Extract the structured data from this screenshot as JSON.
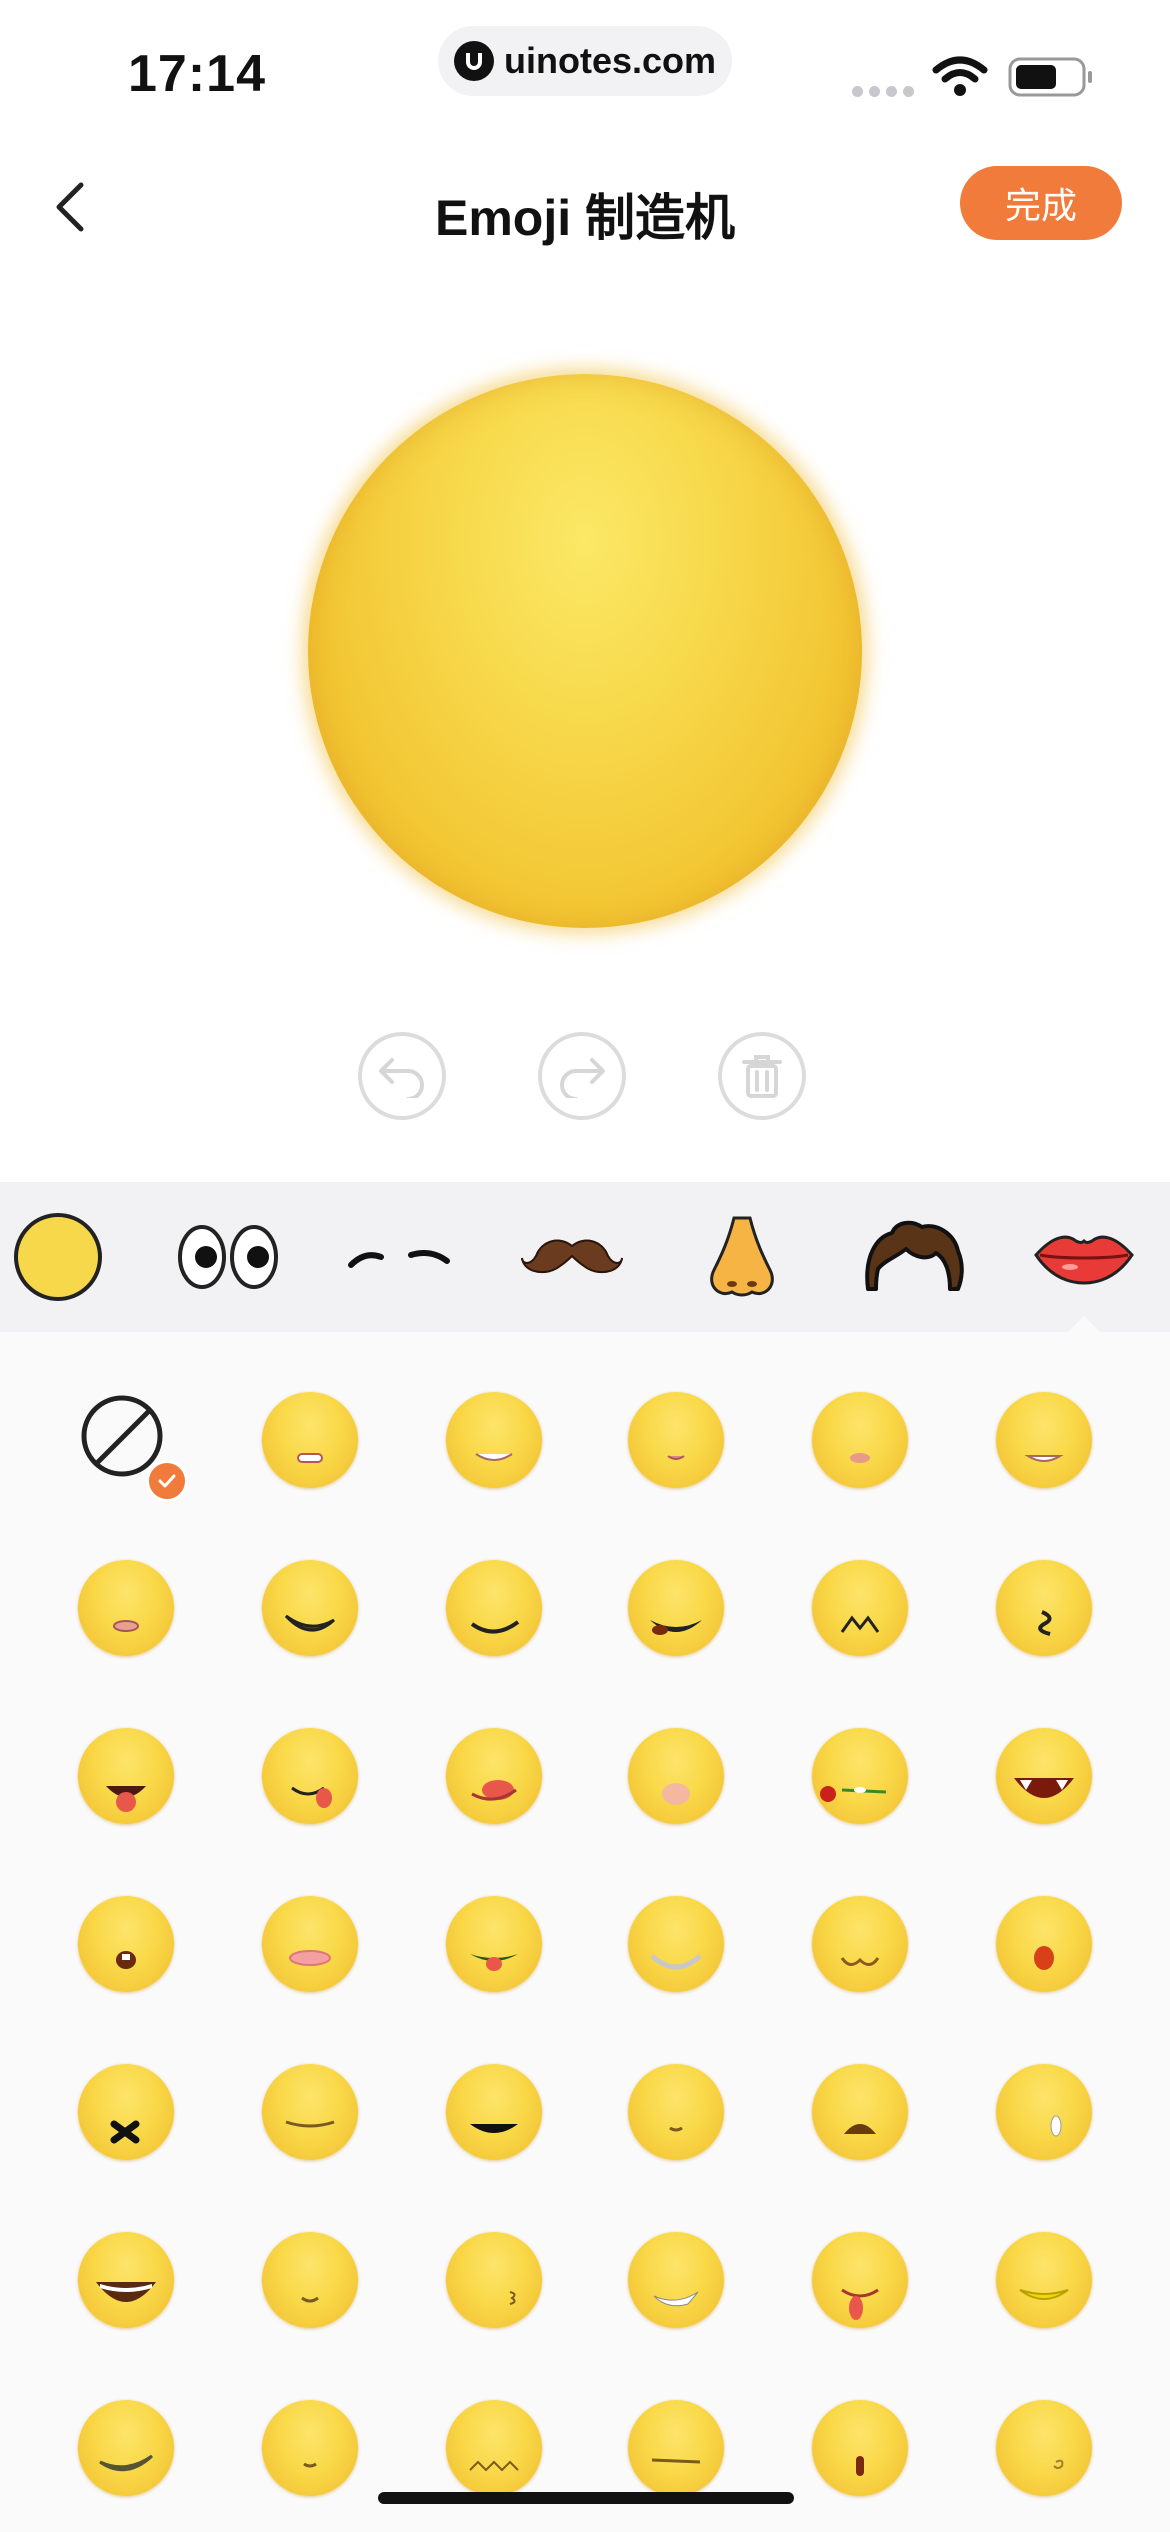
{
  "status_bar": {
    "time": "17:14",
    "url": "uinotes.com"
  },
  "nav": {
    "title": "Emoji 制造机",
    "done_label": "完成"
  },
  "actions": [
    "undo-icon",
    "redo-icon",
    "trash-icon"
  ],
  "categories": [
    "face-base",
    "eyes",
    "eyebrows",
    "mustache",
    "nose",
    "hair",
    "lips"
  ],
  "selected_category": "lips",
  "grid": {
    "selected_option": "none",
    "mouth_styles": [
      "none",
      "teeth-small",
      "teeth-grin",
      "tiny-open",
      "pout",
      "teeth-wide",
      "lips-small",
      "smirk-wide",
      "smile-wide",
      "smile-tongue",
      "fangs-smile",
      "curl",
      "tongue-out",
      "lick-side",
      "lick-corner",
      "open-pink",
      "rose",
      "vampire",
      "drool",
      "open-lips",
      "tongue-green",
      "silver-teeth",
      "w-mouth",
      "red-o",
      "x-mouth",
      "flat-line",
      "dark-grin",
      "small-smile",
      "brown-open",
      "white-drop",
      "big-laugh",
      "tiny-smile",
      "number-3",
      "sparkle-teeth",
      "tongue-drip",
      "yellow-lips",
      "wide-teeth",
      "tiny-smile-2",
      "zigzag",
      "flat-line-2",
      "tall-o",
      "small-curl"
    ]
  },
  "colors": {
    "accent": "#f07b3a",
    "face": "#f7d84a",
    "category_bg": "#f2f2f4"
  }
}
